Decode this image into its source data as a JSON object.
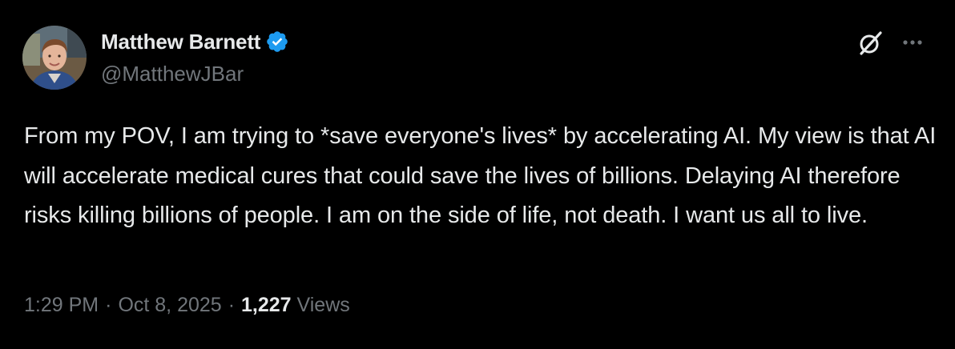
{
  "author": {
    "name": "Matthew Barnett",
    "handle": "@MatthewJBar",
    "verified": true
  },
  "icons": {
    "verified": "verified-badge-icon",
    "grok": "grok-icon",
    "more": "more-options-icon"
  },
  "tweet": {
    "text": "From my POV, I am trying to *save everyone's lives* by accelerating AI. My view is that AI will accelerate medical cures that could save the lives of billions. Delaying AI therefore risks killing billions of people. I am on the side of life, not death. I want us all to live."
  },
  "meta": {
    "time": "1:29 PM",
    "separator": "·",
    "date": "Oct 8, 2025",
    "views_count": "1,227",
    "views_label": "Views"
  },
  "colors": {
    "background": "#000000",
    "text_primary": "#e7e9ea",
    "text_secondary": "#71767b",
    "verified_blue": "#1d9bf0"
  }
}
